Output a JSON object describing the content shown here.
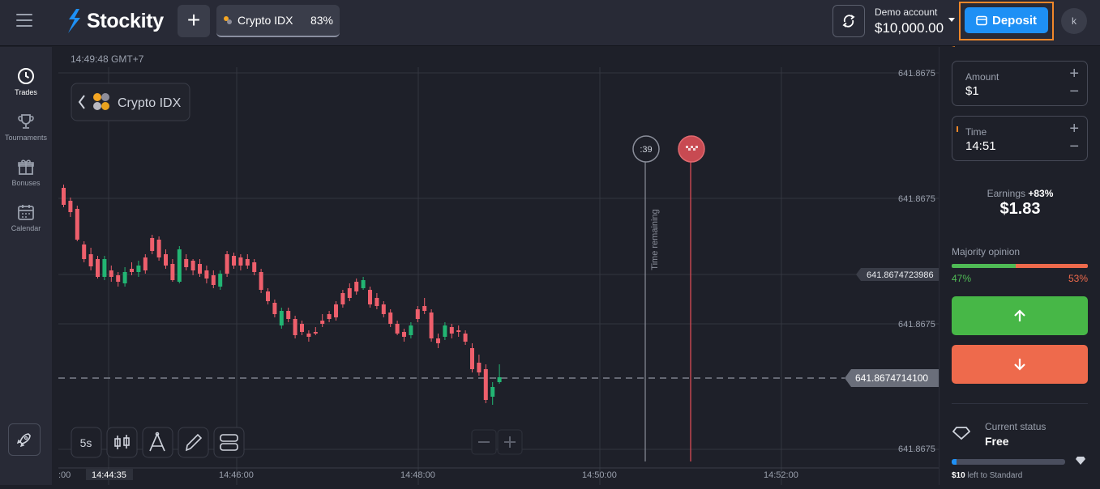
{
  "brand": {
    "name": "Stockity"
  },
  "header": {
    "asset_tab": {
      "name": "Crypto IDX",
      "payout": "83%"
    },
    "account": {
      "label": "Demo account",
      "balance": "$10,000.00"
    },
    "deposit_label": "Deposit",
    "avatar_initial": "k"
  },
  "sidebar": {
    "items": [
      {
        "label": "Trades",
        "icon": "clock-icon",
        "active": true
      },
      {
        "label": "Tournaments",
        "icon": "trophy-icon",
        "active": false
      },
      {
        "label": "Bonuses",
        "icon": "gift-icon",
        "active": false
      },
      {
        "label": "Calendar",
        "icon": "calendar-icon",
        "active": false
      }
    ]
  },
  "chart": {
    "server_time": "14:49:48 GMT+7",
    "asset_label": "Crypto IDX",
    "timeframe": "5s",
    "countdown": ":39",
    "time_remaining_label": "Time remaining",
    "price_labels": [
      "641.8675",
      "641.8675",
      "641.8675",
      "641.8675"
    ],
    "marker_price": "641.8674723986",
    "current_price": "641.8674714100",
    "time_ticks": [
      ":00",
      "14:46:00",
      "14:48:00",
      "14:50:00",
      "14:52:00"
    ],
    "cursor_time": "14:44:35",
    "colors": {
      "up": "#22b573",
      "down": "#ee5f6c"
    }
  },
  "trade_panel": {
    "amount": {
      "label": "Amount",
      "value": "$1"
    },
    "time": {
      "label": "Time",
      "value": "14:51"
    },
    "earnings": {
      "label": "Earnings",
      "percent": "+83%",
      "value": "$1.83"
    },
    "majority": {
      "label": "Majority opinion",
      "up_pct": "47%",
      "down_pct": "53%",
      "up_fraction": 0.47
    },
    "status": {
      "label": "Current status",
      "value": "Free",
      "amount": "$10",
      "note": "left to Standard",
      "progress": 0.04
    }
  }
}
